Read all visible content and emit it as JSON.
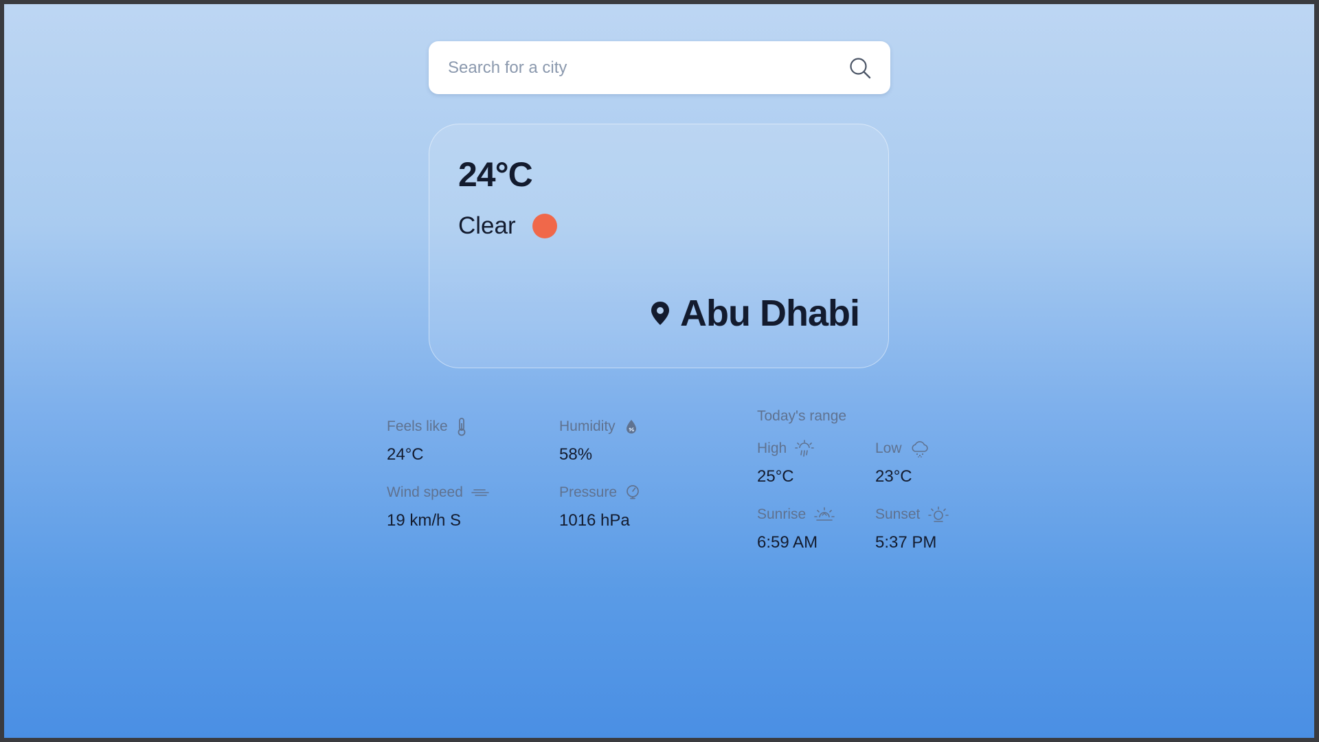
{
  "search": {
    "placeholder": "Search for a city",
    "value": ""
  },
  "current": {
    "temperature": "24°C",
    "condition": "Clear",
    "condition_icon": "sun-dot-icon",
    "condition_color": "#f0684a",
    "city": "Abu Dhabi"
  },
  "details": {
    "feels_like": {
      "label": "Feels like",
      "value": "24°C",
      "icon": "thermometer-icon"
    },
    "humidity": {
      "label": "Humidity",
      "value": "58%",
      "icon": "droplet-icon"
    },
    "wind_speed": {
      "label": "Wind speed",
      "value": "19 km/h S",
      "icon": "wind-icon"
    },
    "pressure": {
      "label": "Pressure",
      "value": "1016 hPa",
      "icon": "gauge-icon"
    }
  },
  "range": {
    "title": "Today's range",
    "high": {
      "label": "High",
      "value": "25°C",
      "icon": "sun-rain-icon"
    },
    "low": {
      "label": "Low",
      "value": "23°C",
      "icon": "cloud-snow-icon"
    },
    "sunrise": {
      "label": "Sunrise",
      "value": "6:59 AM",
      "icon": "sunrise-icon"
    },
    "sunset": {
      "label": "Sunset",
      "value": "5:37 PM",
      "icon": "sunset-icon"
    }
  },
  "colors": {
    "text_primary": "#131b2e",
    "text_muted": "#5f7290",
    "gradient_top": "#bdd6f3",
    "gradient_bottom": "#4a8fe4"
  }
}
